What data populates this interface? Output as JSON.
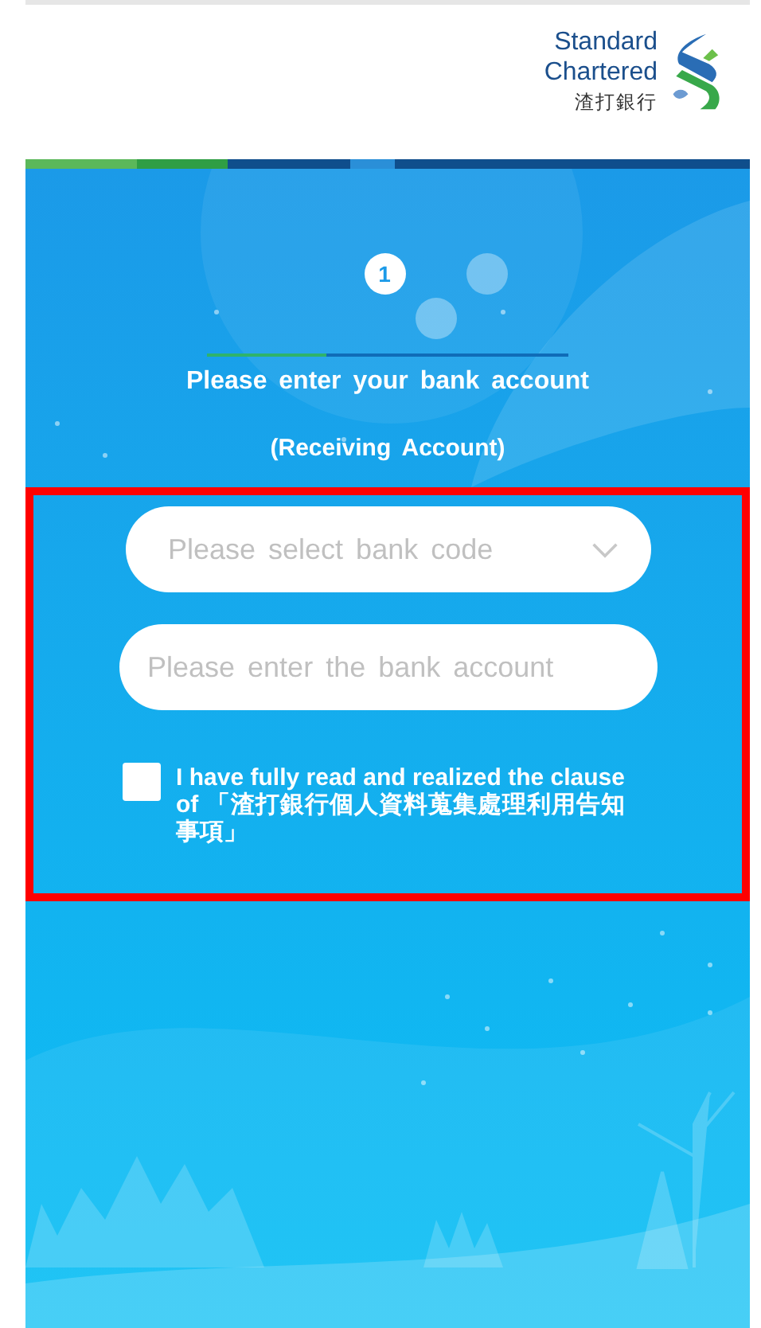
{
  "header": {
    "logo_name": "Standard Chartered",
    "logo_subtitle": "渣打銀行"
  },
  "steps": [
    {
      "label": "1",
      "selected": true
    },
    {
      "selected": false
    },
    {
      "selected": false
    }
  ],
  "step_progress": {
    "level": 0.33
  },
  "title": "Please enter your bank account",
  "subtitle": "(Receiving Account)",
  "form": {
    "bank_code": {
      "placeholder": "Please select bank code"
    },
    "bank_account": {
      "placeholder": "Please enter the bank account"
    },
    "consent": {
      "checked": false,
      "label": "I have fully read and realized the clause of 「渣打銀行個人資料蒐集處理利用告知事項」"
    }
  }
}
